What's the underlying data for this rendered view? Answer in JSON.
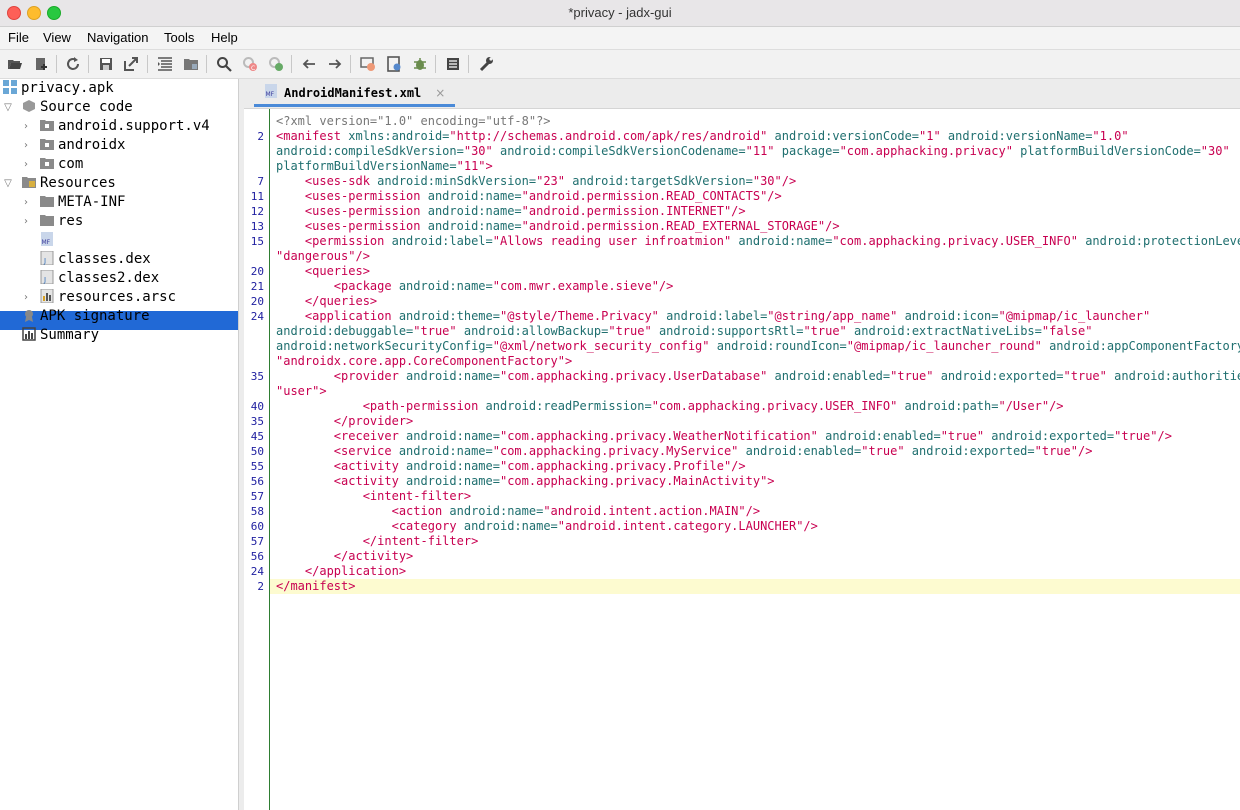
{
  "window": {
    "title": "*privacy - jadx-gui"
  },
  "menu": [
    "File",
    "View",
    "Navigation",
    "Tools",
    "Help"
  ],
  "toolbar_icons": [
    "open-icon",
    "add-files-icon",
    "reload-icon",
    "save-all-icon",
    "export-icon",
    "sync-tree-icon",
    "flatten-packages-icon",
    "search-icon",
    "find-class-icon",
    "find-usage-icon",
    "back-icon",
    "forward-icon",
    "deobfuscation-icon",
    "decompile-all-icon",
    "debugger-icon",
    "log-viewer-icon",
    "preferences-icon"
  ],
  "tree": {
    "root": "privacy.apk",
    "source": "Source code",
    "pkg1": "android.support.v4",
    "pkg2": "androidx",
    "pkg3": "com",
    "resources": "Resources",
    "meta": "META-INF",
    "res": "res",
    "manifest": "AndroidManifest.xml",
    "dex1": "classes.dex",
    "dex2": "classes2.dex",
    "arsc": "resources.arsc",
    "signature": "APK signature",
    "summary": "Summary"
  },
  "tab": {
    "label": "AndroidManifest.xml",
    "close": "×"
  },
  "code": {
    "line_numbers": [
      "",
      "2",
      "",
      "",
      "7",
      "11",
      "12",
      "13",
      "15",
      "",
      "20",
      "21",
      "20",
      "24",
      "",
      "",
      "",
      "35",
      "",
      "40",
      "35",
      "45",
      "50",
      "55",
      "56",
      "57",
      "58",
      "60",
      "57",
      "56",
      "24",
      "2"
    ],
    "lines": [
      [
        [
          "pi",
          "<?xml version=\"1.0\" encoding=\"utf-8\"?>"
        ]
      ],
      [
        [
          "tg",
          "<manifest"
        ],
        [
          "an",
          " xmlns:android="
        ],
        [
          "av",
          "\"http://schemas.android.com/apk/res/android\""
        ],
        [
          "an",
          " android:versionCode="
        ],
        [
          "av",
          "\"1\""
        ],
        [
          "an",
          " android:versionName="
        ],
        [
          "av",
          "\"1.0\""
        ]
      ],
      [
        [
          "an",
          "android:compileSdkVersion="
        ],
        [
          "av",
          "\"30\""
        ],
        [
          "an",
          " android:compileSdkVersionCodename="
        ],
        [
          "av",
          "\"11\""
        ],
        [
          "an",
          " package="
        ],
        [
          "av",
          "\"com.apphacking.privacy\""
        ],
        [
          "an",
          " platformBuildVersionCode="
        ],
        [
          "av",
          "\"30\""
        ]
      ],
      [
        [
          "an",
          "platformBuildVersionName="
        ],
        [
          "av",
          "\"11\""
        ],
        [
          "tg",
          ">"
        ]
      ],
      [
        [
          "tg",
          "    <uses-sdk"
        ],
        [
          "an",
          " android:minSdkVersion="
        ],
        [
          "av",
          "\"23\""
        ],
        [
          "an",
          " android:targetSdkVersion="
        ],
        [
          "av",
          "\"30\""
        ],
        [
          "tg",
          "/>"
        ]
      ],
      [
        [
          "tg",
          "    <uses-permission"
        ],
        [
          "an",
          " android:name="
        ],
        [
          "av",
          "\"android.permission.READ_CONTACTS\""
        ],
        [
          "tg",
          "/>"
        ]
      ],
      [
        [
          "tg",
          "    <uses-permission"
        ],
        [
          "an",
          " android:name="
        ],
        [
          "av",
          "\"android.permission.INTERNET\""
        ],
        [
          "tg",
          "/>"
        ]
      ],
      [
        [
          "tg",
          "    <uses-permission"
        ],
        [
          "an",
          " android:name="
        ],
        [
          "av",
          "\"android.permission.READ_EXTERNAL_STORAGE\""
        ],
        [
          "tg",
          "/>"
        ]
      ],
      [
        [
          "tg",
          "    <permission"
        ],
        [
          "an",
          " android:label="
        ],
        [
          "av",
          "\"Allows reading user infroatmion\""
        ],
        [
          "an",
          " android:name="
        ],
        [
          "av",
          "\"com.apphacking.privacy.USER_INFO\""
        ],
        [
          "an",
          " android:protectionLevel="
        ]
      ],
      [
        [
          "av",
          "\"dangerous\""
        ],
        [
          "tg",
          "/>"
        ]
      ],
      [
        [
          "tg",
          "    <queries>"
        ]
      ],
      [
        [
          "tg",
          "        <package"
        ],
        [
          "an",
          " android:name="
        ],
        [
          "av",
          "\"com.mwr.example.sieve\""
        ],
        [
          "tg",
          "/>"
        ]
      ],
      [
        [
          "tg",
          "    </queries>"
        ]
      ],
      [
        [
          "tg",
          "    <application"
        ],
        [
          "an",
          " android:theme="
        ],
        [
          "av",
          "\"@style/Theme.Privacy\""
        ],
        [
          "an",
          " android:label="
        ],
        [
          "av",
          "\"@string/app_name\""
        ],
        [
          "an",
          " android:icon="
        ],
        [
          "av",
          "\"@mipmap/ic_launcher\""
        ]
      ],
      [
        [
          "an",
          "android:debuggable="
        ],
        [
          "av",
          "\"true\""
        ],
        [
          "an",
          " android:allowBackup="
        ],
        [
          "av",
          "\"true\""
        ],
        [
          "an",
          " android:supportsRtl="
        ],
        [
          "av",
          "\"true\""
        ],
        [
          "an",
          " android:extractNativeLibs="
        ],
        [
          "av",
          "\"false\""
        ]
      ],
      [
        [
          "an",
          "android:networkSecurityConfig="
        ],
        [
          "av",
          "\"@xml/network_security_config\""
        ],
        [
          "an",
          " android:roundIcon="
        ],
        [
          "av",
          "\"@mipmap/ic_launcher_round\""
        ],
        [
          "an",
          " android:appComponentFactory="
        ]
      ],
      [
        [
          "av",
          "\"androidx.core.app.CoreComponentFactory\""
        ],
        [
          "tg",
          ">"
        ]
      ],
      [
        [
          "tg",
          "        <provider"
        ],
        [
          "an",
          " android:name="
        ],
        [
          "av",
          "\"com.apphacking.privacy.UserDatabase\""
        ],
        [
          "an",
          " android:enabled="
        ],
        [
          "av",
          "\"true\""
        ],
        [
          "an",
          " android:exported="
        ],
        [
          "av",
          "\"true\""
        ],
        [
          "an",
          " android:authorities="
        ]
      ],
      [
        [
          "av",
          "\"user\""
        ],
        [
          "tg",
          ">"
        ]
      ],
      [
        [
          "tg",
          "            <path-permission"
        ],
        [
          "an",
          " android:readPermission="
        ],
        [
          "av",
          "\"com.apphacking.privacy.USER_INFO\""
        ],
        [
          "an",
          " android:path="
        ],
        [
          "av",
          "\"/User\""
        ],
        [
          "tg",
          "/>"
        ]
      ],
      [
        [
          "tg",
          "        </provider>"
        ]
      ],
      [
        [
          "tg",
          "        <receiver"
        ],
        [
          "an",
          " android:name="
        ],
        [
          "av",
          "\"com.apphacking.privacy.WeatherNotification\""
        ],
        [
          "an",
          " android:enabled="
        ],
        [
          "av",
          "\"true\""
        ],
        [
          "an",
          " android:exported="
        ],
        [
          "av",
          "\"true\""
        ],
        [
          "tg",
          "/>"
        ]
      ],
      [
        [
          "tg",
          "        <service"
        ],
        [
          "an",
          " android:name="
        ],
        [
          "av",
          "\"com.apphacking.privacy.MyService\""
        ],
        [
          "an",
          " android:enabled="
        ],
        [
          "av",
          "\"true\""
        ],
        [
          "an",
          " android:exported="
        ],
        [
          "av",
          "\"true\""
        ],
        [
          "tg",
          "/>"
        ]
      ],
      [
        [
          "tg",
          "        <activity"
        ],
        [
          "an",
          " android:name="
        ],
        [
          "av",
          "\"com.apphacking.privacy.Profile\""
        ],
        [
          "tg",
          "/>"
        ]
      ],
      [
        [
          "tg",
          "        <activity"
        ],
        [
          "an",
          " android:name="
        ],
        [
          "av",
          "\"com.apphacking.privacy.MainActivity\""
        ],
        [
          "tg",
          ">"
        ]
      ],
      [
        [
          "tg",
          "            <intent-filter>"
        ]
      ],
      [
        [
          "tg",
          "                <action"
        ],
        [
          "an",
          " android:name="
        ],
        [
          "av",
          "\"android.intent.action.MAIN\""
        ],
        [
          "tg",
          "/>"
        ]
      ],
      [
        [
          "tg",
          "                <category"
        ],
        [
          "an",
          " android:name="
        ],
        [
          "av",
          "\"android.intent.category.LAUNCHER\""
        ],
        [
          "tg",
          "/>"
        ]
      ],
      [
        [
          "tg",
          "            </intent-filter>"
        ]
      ],
      [
        [
          "tg",
          "        </activity>"
        ]
      ],
      [
        [
          "tg",
          "    </application>"
        ]
      ],
      [
        [
          "tg",
          "</manifest>"
        ]
      ]
    ]
  }
}
